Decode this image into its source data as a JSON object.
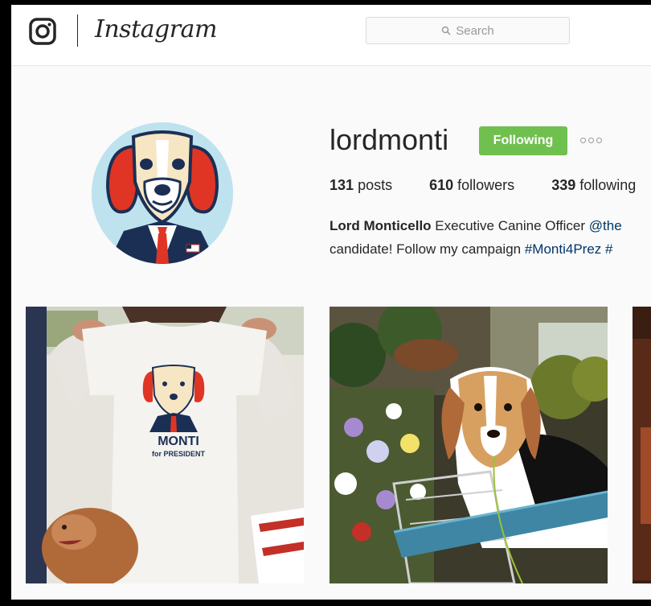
{
  "header": {
    "logo_text": "Instagram",
    "search_placeholder": "Search"
  },
  "profile": {
    "username": "lordmonti",
    "follow_button": "Following",
    "stats": [
      {
        "count": "131",
        "label": "posts"
      },
      {
        "count": "610",
        "label": "followers"
      },
      {
        "count": "339",
        "label": "following"
      }
    ],
    "bio": {
      "name": "Lord Monticello",
      "line1_text": " Executive Canine Officer ",
      "line1_mention": "@the",
      "line2_text": "candidate! Follow my campaign ",
      "line2_hashtag": "#Monti4Prez",
      "line2_tail": " #"
    }
  },
  "posts": [
    {
      "shirt_text_1": "MONTI",
      "shirt_text_2": "for PRESIDENT"
    },
    {},
    {}
  ],
  "colors": {
    "follow_green": "#70c050",
    "link_blue": "#003569",
    "text": "#262626"
  }
}
